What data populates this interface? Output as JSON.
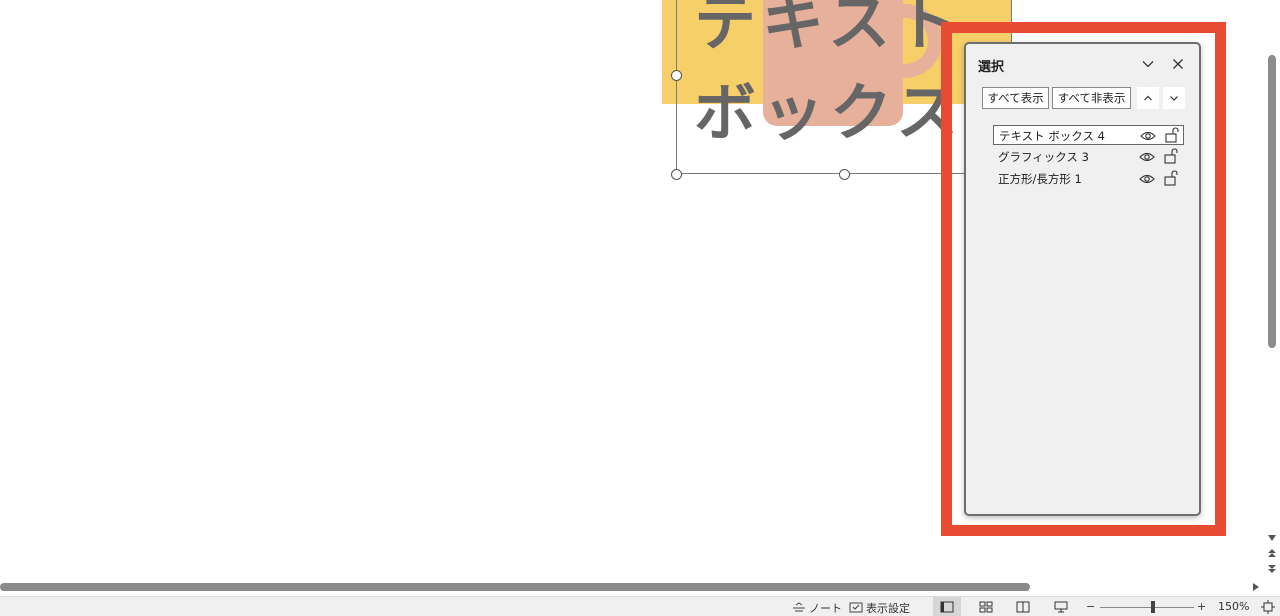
{
  "slide": {
    "textbox_line1": "テキスト",
    "textbox_line2": "ボックス",
    "colors": {
      "yellow": "#f6cf69",
      "mug": "#e7b09b",
      "text": "#666666"
    }
  },
  "highlight": {
    "color": "#e74c32"
  },
  "selection_pane": {
    "title": "選択",
    "icons": {
      "collapse": "chevron-down-icon",
      "close": "close-icon"
    },
    "show_all_label": "すべて表示",
    "hide_all_label": "すべて非表示",
    "bring_forward_icon": "chevron-up-icon",
    "send_backward_icon": "chevron-down-icon",
    "layers": [
      {
        "label": "テキスト ボックス 4",
        "selected": true,
        "visible": true,
        "locked": false
      },
      {
        "label": "グラフィックス 3",
        "selected": false,
        "visible": true,
        "locked": false
      },
      {
        "label": "正方形/長方形 1",
        "selected": false,
        "visible": true,
        "locked": false
      }
    ]
  },
  "status_bar": {
    "notes_label": "ノート",
    "display_settings_label": "表示設定",
    "zoom_minus": "−",
    "zoom_plus": "+",
    "zoom_level": "150%"
  }
}
